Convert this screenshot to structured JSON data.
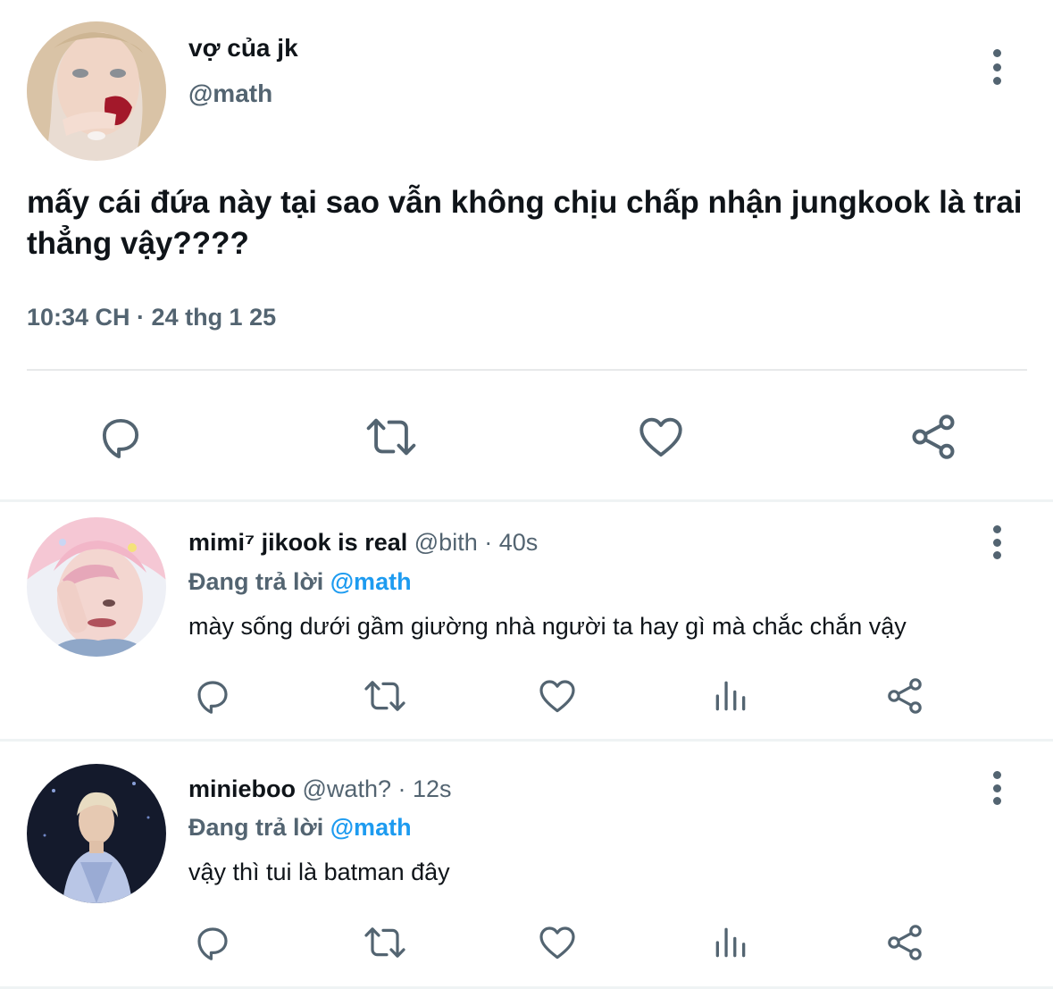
{
  "main_tweet": {
    "display_name": "vợ của jk",
    "handle": "@math",
    "text": "mấy cái đứa này tại sao vẫn không chịu chấp nhận jungkook là trai thẳng vậy????",
    "timestamp": "10:34 CH · 24 thg 1 25",
    "actions": [
      "reply-icon",
      "retweet-icon",
      "like-icon",
      "share-icon"
    ],
    "more_icon": "more-vertical-icon"
  },
  "replies": [
    {
      "display_name": "mimi⁷ jikook is real",
      "handle": "@bith",
      "dot": "·",
      "time": "40s",
      "replying_prefix": "Đang trả lời",
      "replying_to": "@math",
      "text": "mày sống dưới gầm giường nhà người ta hay gì mà chắc chắn vậy",
      "actions": [
        "reply-icon",
        "retweet-icon",
        "like-icon",
        "views-icon",
        "share-icon"
      ]
    },
    {
      "display_name": "minieboo",
      "handle": "@wath?",
      "dot": "·",
      "time": "12s",
      "replying_prefix": "Đang trả lời",
      "replying_to": "@math",
      "text": "vậy thì tui là batman đây",
      "actions": [
        "reply-icon",
        "retweet-icon",
        "like-icon",
        "views-icon",
        "share-icon"
      ]
    }
  ],
  "colors": {
    "text_primary": "#0f1419",
    "text_secondary": "#536471",
    "link": "#1d9bf0",
    "divider": "#eff3f4"
  }
}
